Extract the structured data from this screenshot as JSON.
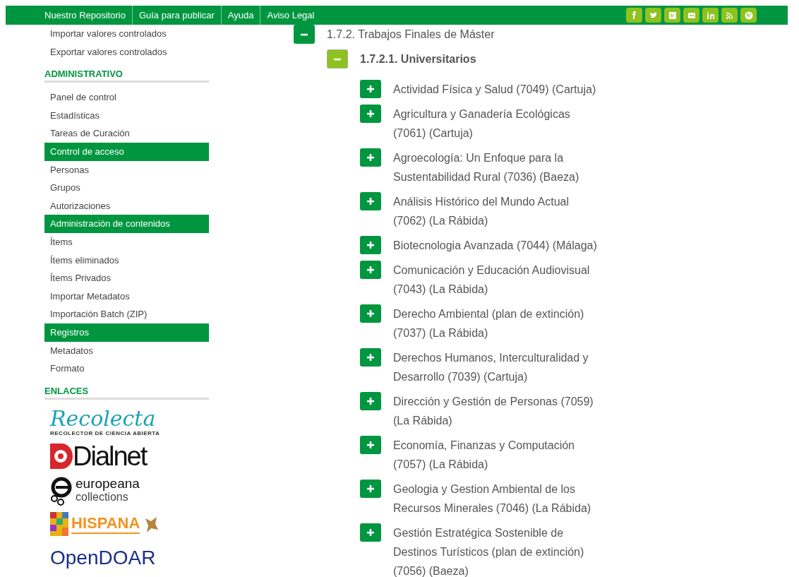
{
  "navbar": {
    "links": [
      "Nuestro Repositorio",
      "Guía para publicar",
      "Ayuda",
      "Aviso Legal"
    ],
    "social": [
      {
        "kind": "facebook"
      },
      {
        "kind": "twitter"
      },
      {
        "kind": "vimeo"
      },
      {
        "kind": "flickr"
      },
      {
        "kind": "linkedin"
      },
      {
        "kind": "rss"
      },
      {
        "kind": "globe"
      }
    ]
  },
  "sidebar": {
    "items": [
      {
        "label": "Importar valores controlados",
        "kind": "link"
      },
      {
        "label": "Exportar valores controlados",
        "kind": "link"
      },
      {
        "label": "ADMINISTRATIVO",
        "kind": "section"
      },
      {
        "label": "Panel de control",
        "kind": "link"
      },
      {
        "label": "Estadísticas",
        "kind": "link"
      },
      {
        "label": "Tareas de Curación",
        "kind": "link"
      },
      {
        "label": "Control de acceso",
        "kind": "header"
      },
      {
        "label": "Personas",
        "kind": "link"
      },
      {
        "label": "Grupos",
        "kind": "link"
      },
      {
        "label": "Autorizaciones",
        "kind": "link"
      },
      {
        "label": "Administración de contenidos",
        "kind": "header"
      },
      {
        "label": "Ítems",
        "kind": "link"
      },
      {
        "label": "Ítems eliminados",
        "kind": "link"
      },
      {
        "label": "Ítems Privados",
        "kind": "link"
      },
      {
        "label": "Importar Metadatos",
        "kind": "link"
      },
      {
        "label": "Importación Batch (ZIP)",
        "kind": "link"
      },
      {
        "label": "Registros",
        "kind": "header"
      },
      {
        "label": "Metadatos",
        "kind": "link"
      },
      {
        "label": "Formato",
        "kind": "link"
      },
      {
        "label": "ENLACES",
        "kind": "section"
      }
    ],
    "logos": [
      {
        "kind": "recolecta",
        "text": "Recolecta",
        "subtitle": "RECOLECTOR DE CIENCIA ABIERTA"
      },
      {
        "kind": "dialnet",
        "text": "Dialnet"
      },
      {
        "kind": "europeana",
        "text": "europeana",
        "subtitle": "collections"
      },
      {
        "kind": "hispana",
        "text": "HISPANA"
      },
      {
        "kind": "opendoar",
        "text": "OpenDOAR"
      }
    ]
  },
  "tree": [
    {
      "label": "1.7.2. Trabajos Finales de Máster",
      "expanded": true,
      "children": [
        {
          "label": "1.7.2.1. Universitarios",
          "expanded": true,
          "children": [
            {
              "label": "Actividad Física y Salud (7049) (Cartuja)",
              "expanded": false
            },
            {
              "label": "Agricultura y Ganadería Ecológicas (7061) (Cartuja)",
              "expanded": false
            },
            {
              "label": "Agroecología: Un Enfoque para la Sustentabilidad Rural (7036) (Baeza)",
              "expanded": false
            },
            {
              "label": "Análisis Histórico del Mundo Actual (7062) (La Rábida)",
              "expanded": false
            },
            {
              "label": "Biotecnologia Avanzada (7044) (Málaga)",
              "expanded": false
            },
            {
              "label": "Comunicación y Educación Audiovisual (7043) (La Rábida)",
              "expanded": false
            },
            {
              "label": "Derecho Ambiental (plan de extinción) (7037) (La Rábida)",
              "expanded": false
            },
            {
              "label": "Derechos Humanos, Interculturalidad y Desarrollo (7039) (Cartuja)",
              "expanded": false
            },
            {
              "label": "Dirección y Gestión de Personas (7059) (La Rábida)",
              "expanded": false
            },
            {
              "label": "Economía, Finanzas y Computación (7057) (La Rábida)",
              "expanded": false
            },
            {
              "label": "Geologia y Gestion Ambiental de los Recursos Minerales (7046) (La Rábida)",
              "expanded": false
            },
            {
              "label": "Gestión Estratégica Sostenible de Destinos Turísticos (plan de extinción) (7056) (Baeza)",
              "expanded": false
            }
          ]
        }
      ]
    }
  ]
}
